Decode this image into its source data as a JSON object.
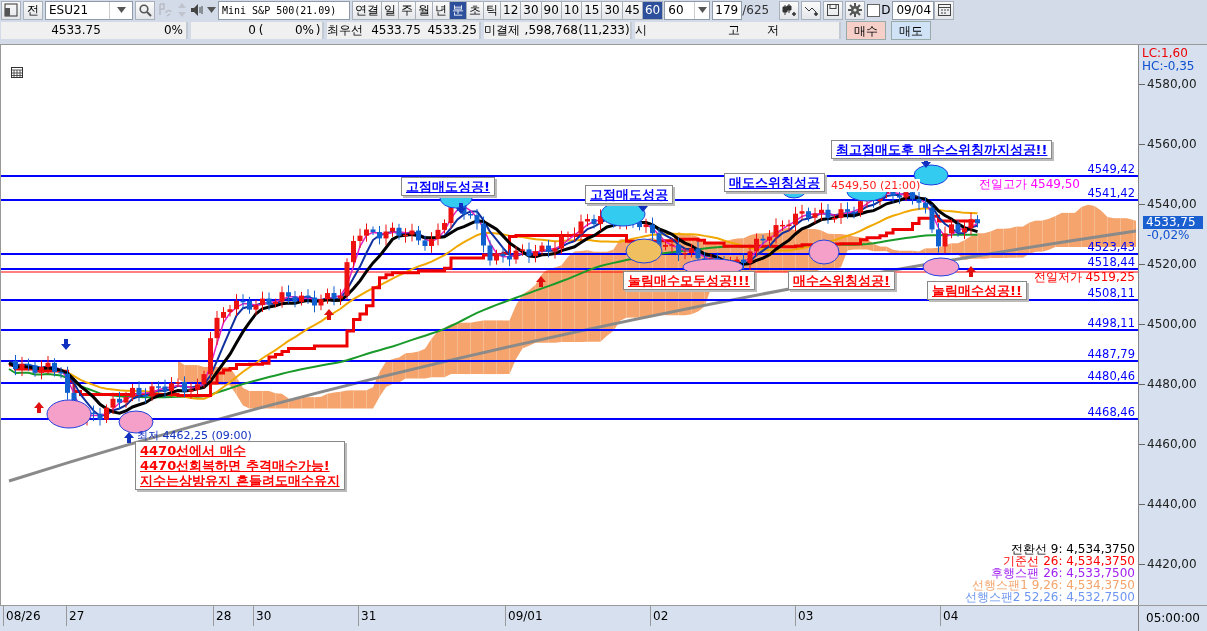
{
  "toolbar": {
    "front_button": "전",
    "symbol": "ESU21",
    "instrument": "Mini S&P 500(21.09)",
    "periods": [
      {
        "label": "연결",
        "selected": false
      },
      {
        "label": "일",
        "selected": false
      },
      {
        "label": "주",
        "selected": false
      },
      {
        "label": "월",
        "selected": false
      },
      {
        "label": "년",
        "selected": false
      },
      {
        "label": "분",
        "selected": true
      },
      {
        "label": "초",
        "selected": false
      },
      {
        "label": "틱",
        "selected": false
      },
      {
        "label": "12",
        "selected": false
      },
      {
        "label": "30",
        "selected": false
      },
      {
        "label": "90",
        "selected": false
      },
      {
        "label": "10",
        "selected": false
      },
      {
        "label": "15",
        "selected": false
      },
      {
        "label": "30",
        "selected": false
      },
      {
        "label": "45",
        "selected": false
      },
      {
        "label": "60",
        "selected": true
      }
    ],
    "interval": "60",
    "count": "179",
    "total": "/625",
    "d_checkbox": {
      "label": "D",
      "checked": false
    },
    "date": "09/04"
  },
  "quote_bar": {
    "cells": [
      "4533.75",
      "0%",
      "0",
      "(",
      "0%",
      ")",
      "최우선",
      "4533.75",
      "4533.25",
      "미결제",
      ",598,768",
      "(11,233)",
      "시",
      "고",
      "저"
    ],
    "buy_button": "매수",
    "sell_button": "매도"
  },
  "chart": {
    "levels": [
      {
        "value": "4549,42"
      },
      {
        "value": "4541,42"
      },
      {
        "value": "4523,43"
      },
      {
        "value": "4518,44"
      },
      {
        "value": "4508,11"
      },
      {
        "value": "4498,11"
      },
      {
        "value": "4487,79"
      },
      {
        "value": "4480,46"
      },
      {
        "value": "4468,46"
      }
    ],
    "prev_high": "전일고가 4549,50",
    "prev_low": "전일저가 4519,25",
    "high_marker": "4549,50 (21:00)",
    "low_marker": "최저 4462,25 (09:00)",
    "annotations": [
      {
        "lines": [
          "고점매도성공!"
        ],
        "color": "#0000ff"
      },
      {
        "lines": [
          "고점매도성공"
        ],
        "color": "#0000ff"
      },
      {
        "lines": [
          "매도스위칭성공"
        ],
        "color": "#0000ff"
      },
      {
        "lines": [
          "최고점매도후 매수스위칭까지성공!!"
        ],
        "color": "#0000ff"
      },
      {
        "lines": [
          "눌림매수모두성공!!!"
        ],
        "color": "#ff0000"
      },
      {
        "lines": [
          "매수스위칭성공!"
        ],
        "color": "#ff0000"
      },
      {
        "lines": [
          "눌림매수성공!!"
        ],
        "color": "#ff0000"
      },
      {
        "lines": [
          "4470선에서 매수",
          "4470선회복하면 추격매수가능!",
          "지수는상방유지 흔들려도매수유지"
        ],
        "color": "#ff0000"
      }
    ],
    "legend": [
      {
        "text": "전환선 9: 4,534,3750",
        "color": "#000000"
      },
      {
        "text": "기준선 26: 4,534,3750",
        "color": "#ff0000"
      },
      {
        "text": "후행스팬 26: 4,533,7500",
        "color": "#a020f0"
      },
      {
        "text": "선행스팬1 9,26: 4,534,3750",
        "color": "#f4a46c"
      },
      {
        "text": "선행스팬2 52,26: 4,532,7500",
        "color": "#6c96f0"
      }
    ]
  },
  "price_axis": {
    "lc": "LC:1,60",
    "hc": "HC:-0,35",
    "ticks": [
      "4580,00",
      "4560,00",
      "4540,00",
      "4520,00",
      "4500,00",
      "4480,00",
      "4460,00",
      "4440,00",
      "4420,00"
    ],
    "current": "4533,75",
    "change": "-0,02%"
  },
  "time_axis": {
    "labels": [
      "08/26",
      "27",
      "28",
      "30",
      "31",
      "09/01",
      "02",
      "03",
      "04"
    ],
    "time": "05:00:00"
  }
}
